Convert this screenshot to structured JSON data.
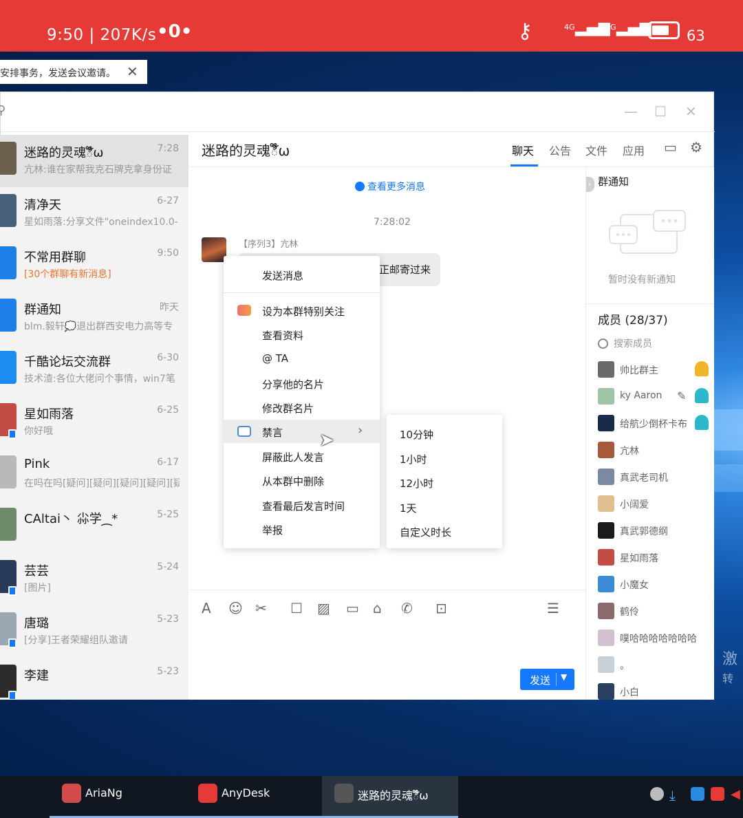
{
  "statusbar": {
    "time": "9:50 | 207K/s",
    "record_icon": "•0•",
    "net1": "4G",
    "net2": "3G",
    "battery": "63"
  },
  "notification": {
    "text": "安排事务，发送会议邀请。",
    "close": "✕"
  },
  "window": {
    "minimize": "—",
    "maximize": "☐",
    "close": "✕"
  },
  "sessions": [
    {
      "name": "迷路的灵魂ి໊ω",
      "time": "7:28",
      "last": "亢林:谁在家帮我克石牌克拿身份证",
      "avatar": "#6b5e4a",
      "active": true,
      "badge": false,
      "warn": false
    },
    {
      "name": "清净天",
      "time": "6-27",
      "last": "星如雨落:分享文件\"oneindex10.0-",
      "avatar": "#47617a",
      "active": false,
      "badge": false,
      "warn": false
    },
    {
      "name": "不常用群聊",
      "time": "9:50",
      "last": "[30个群聊有新消息]",
      "avatar": "#1f7fe8",
      "active": false,
      "badge": false,
      "warn": true
    },
    {
      "name": "群通知",
      "time": "昨天",
      "last": "blm.毅轩💭退出群西安电力高等专",
      "avatar": "#1f7fe8",
      "active": false,
      "badge": false,
      "warn": false
    },
    {
      "name": "千酷论坛交流群",
      "time": "6-30",
      "last": "技术渣:各位大佬问个事情，win7笔",
      "avatar": "#1b8cf0",
      "active": false,
      "badge": false,
      "warn": false
    },
    {
      "name": "星如雨落",
      "time": "6-25",
      "last": "你好哦",
      "avatar": "#c44c46",
      "active": false,
      "badge": true,
      "warn": false
    },
    {
      "name": "Pink",
      "time": "6-17",
      "last": "在吗在吗[疑问][疑问][疑问][疑问][疑",
      "avatar": "#b9b9b9",
      "active": false,
      "badge": false,
      "warn": false
    },
    {
      "name": "CAltai丶 尛学⁔*",
      "time": "5-25",
      "last": "",
      "avatar": "#6e8a6a",
      "active": false,
      "badge": false,
      "warn": false
    },
    {
      "name": "芸芸",
      "time": "5-24",
      "last": "[图片]",
      "avatar": "#2a3a5a",
      "active": false,
      "badge": true,
      "warn": false
    },
    {
      "name": "唐璐",
      "time": "5-23",
      "last": "[分享]王者荣耀组队邀请",
      "avatar": "#9aa8b4",
      "active": false,
      "badge": true,
      "warn": false
    },
    {
      "name": "李建",
      "time": "5-23",
      "last": "",
      "avatar": "#2b2b2b",
      "active": false,
      "badge": true,
      "warn": false
    }
  ],
  "chat": {
    "title": "迷路的灵魂ి໊ω",
    "tabs": [
      "聊天",
      "公告",
      "文件",
      "应用"
    ],
    "load_more": "查看更多消息",
    "timestamp": "7:28:02",
    "sender": "【序列3】亢林",
    "message": "正邮寄过来"
  },
  "panel": {
    "notice_title": "群通知",
    "empty_text": "暂时没有新通知",
    "members_title": "成员 (28/37)",
    "search_placeholder": "搜索成员",
    "members": [
      {
        "name": "帅比群主",
        "color": "#6a6a6a",
        "role": "owner"
      },
      {
        "name": "ky Aaron",
        "color": "#9fc5a6",
        "role": "admin-edit"
      },
      {
        "name": "给航少倒杯卡布",
        "color": "#1a2a4a",
        "role": "admin"
      },
      {
        "name": "亢林",
        "color": "#a55a3a",
        "role": ""
      },
      {
        "name": "真武老司机",
        "color": "#7a8aa0",
        "role": ""
      },
      {
        "name": "小阔爱",
        "color": "#e0c090",
        "role": ""
      },
      {
        "name": "真武郭德纲",
        "color": "#1a1a1a",
        "role": ""
      },
      {
        "name": "星如雨落",
        "color": "#c44c46",
        "role": ""
      },
      {
        "name": "小魔女",
        "color": "#3a8ad6",
        "role": ""
      },
      {
        "name": "鹤伶",
        "color": "#8a6a6a",
        "role": ""
      },
      {
        "name": "噗哈哈哈哈哈哈哈",
        "color": "#d0c0d0",
        "role": ""
      },
      {
        "name": "。",
        "color": "#c8d0d8",
        "role": ""
      },
      {
        "name": "小白",
        "color": "#2a4060",
        "role": ""
      }
    ]
  },
  "composer": {
    "send_label": "发送",
    "send_arrow": "▼"
  },
  "context_menu": {
    "items": [
      "发送消息",
      "设为本群特别关注",
      "查看资料",
      "@ TA",
      "分享他的名片",
      "修改群名片",
      "禁言",
      "屏蔽此人发言",
      "从本群中删除",
      "查看最后发言时间",
      "举报"
    ],
    "submenu": [
      "10分钟",
      "1小时",
      "12小时",
      "1天",
      "自定义时长"
    ]
  },
  "watermark": {
    "line1": "激",
    "line2": "转"
  },
  "taskbar": [
    {
      "label": "AriaNg",
      "color": "#d04a4a"
    },
    {
      "label": "AnyDesk",
      "color": "#e53a35"
    },
    {
      "label": "迷路的灵魂ి໊ω",
      "color": "#555"
    }
  ]
}
